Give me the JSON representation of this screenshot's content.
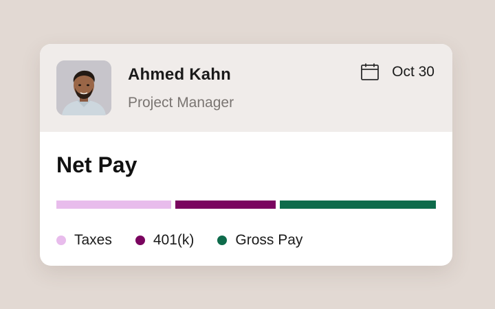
{
  "employee": {
    "name": "Ahmed Kahn",
    "role": "Project Manager"
  },
  "date": {
    "label": "Oct 30",
    "icon": "calendar-icon"
  },
  "net_pay": {
    "title": "Net Pay"
  },
  "breakdown": [
    {
      "name": "Taxes",
      "color": "#e8bcec",
      "share": 0.31
    },
    {
      "name": "401(k)",
      "color": "#7a045f",
      "share": 0.27
    },
    {
      "name": "Gross Pay",
      "color": "#0e6b4b",
      "share": 0.42
    }
  ]
}
